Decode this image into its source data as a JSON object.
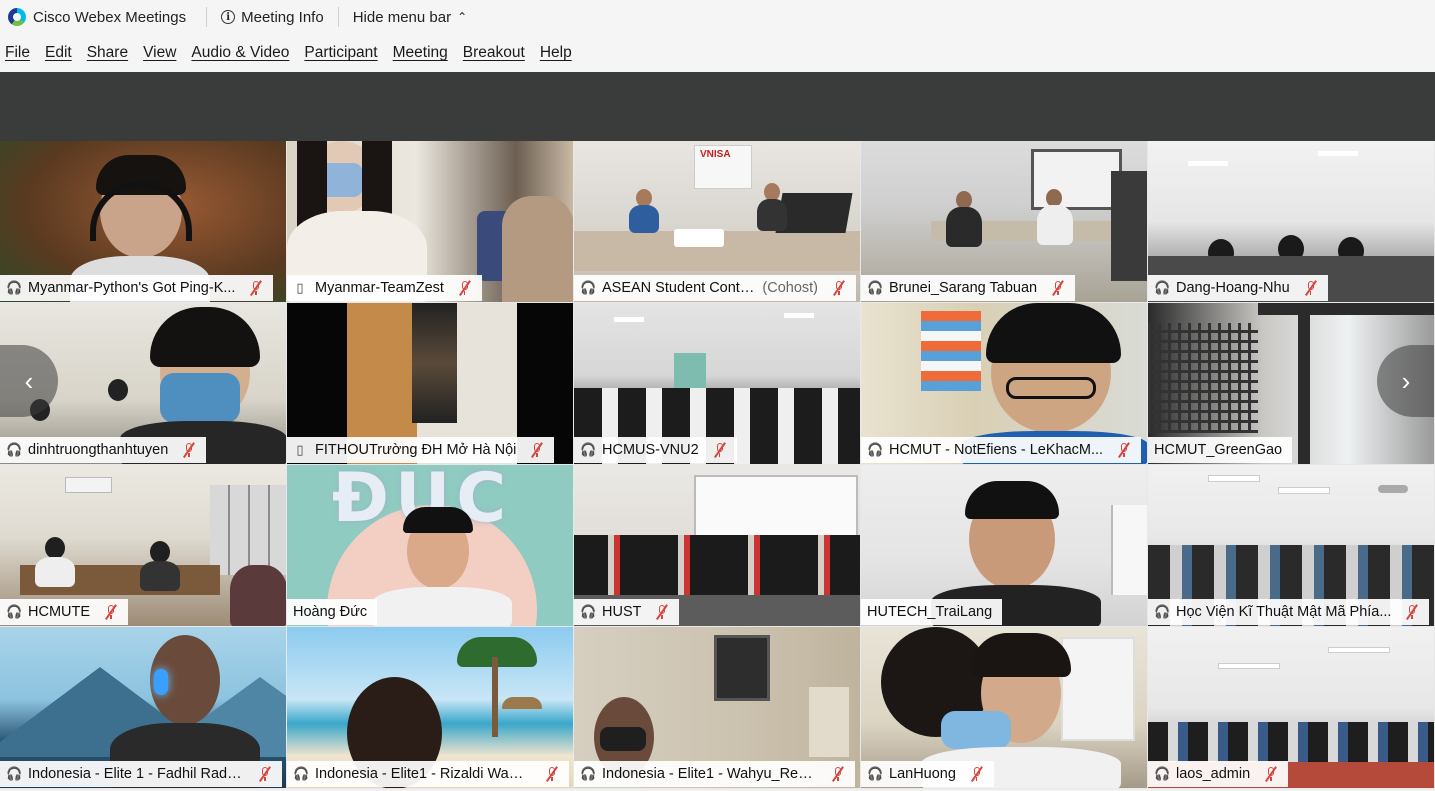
{
  "titlebar": {
    "app_title": "Cisco Webex Meetings",
    "meeting_info": "Meeting Info",
    "hide_menu": "Hide menu bar",
    "logo_icon": "webex-logo",
    "info_icon": "info-circle-icon",
    "chevron_icon": "chevron-up-icon"
  },
  "menu": [
    "File",
    "Edit",
    "Share",
    "View",
    "Audio & Video",
    "Participant",
    "Meeting",
    "Breakout",
    "Help"
  ],
  "participants": [
    {
      "name": "Myanmar-Python's Got Ping-K...",
      "device": "headset",
      "muted": true
    },
    {
      "name": "Myanmar-TeamZest",
      "device": "phone",
      "muted": true
    },
    {
      "name": "ASEAN Student Conte...",
      "role": "(Cohost)",
      "device": "headset",
      "muted": true
    },
    {
      "name": "Brunei_Sarang Tabuan",
      "device": "headset",
      "muted": true
    },
    {
      "name": "Dang-Hoang-Nhu",
      "device": "headset",
      "muted": true
    },
    {
      "name": "dinhtruongthanhtuyen",
      "device": "headset",
      "muted": true
    },
    {
      "name": "FITHOUTrường ĐH Mở Hà Nội",
      "device": "phone",
      "muted": true
    },
    {
      "name": "HCMUS-VNU2",
      "device": "headset",
      "muted": true
    },
    {
      "name": "HCMUT - NotEfiens - LeKhacM...",
      "device": "headset",
      "muted": true
    },
    {
      "name": "HCMUT_GreenGao",
      "device": "none",
      "muted": false
    },
    {
      "name": "HCMUTE",
      "device": "headset",
      "muted": true
    },
    {
      "name": "Hoàng Đức",
      "device": "none",
      "muted": false
    },
    {
      "name": "HUST",
      "device": "headset",
      "muted": true
    },
    {
      "name": "HUTECH_TraiLang",
      "device": "none",
      "muted": false
    },
    {
      "name": "Học Viện Kĩ Thuật Mật Mã Phía...",
      "device": "headset",
      "muted": true
    },
    {
      "name": "Indonesia - Elite 1 - Fadhil Radit...",
      "device": "headset",
      "muted": true
    },
    {
      "name": "Indonesia - Elite1 - Rizaldi Wahaz",
      "device": "headset",
      "muted": true
    },
    {
      "name": "Indonesia - Elite1 - Wahyu_Ren...",
      "device": "headset",
      "muted": true
    },
    {
      "name": "LanHuong",
      "device": "headset",
      "muted": true
    },
    {
      "name": "laos_admin",
      "device": "headset",
      "muted": true
    }
  ],
  "video_text": {
    "vnisa_sign": "VNISA",
    "duc_balloon": "ĐUC"
  },
  "nav": {
    "prev_icon": "chevron-left-icon",
    "next_icon": "chevron-right-icon",
    "prev_glyph": "‹",
    "next_glyph": "›"
  }
}
